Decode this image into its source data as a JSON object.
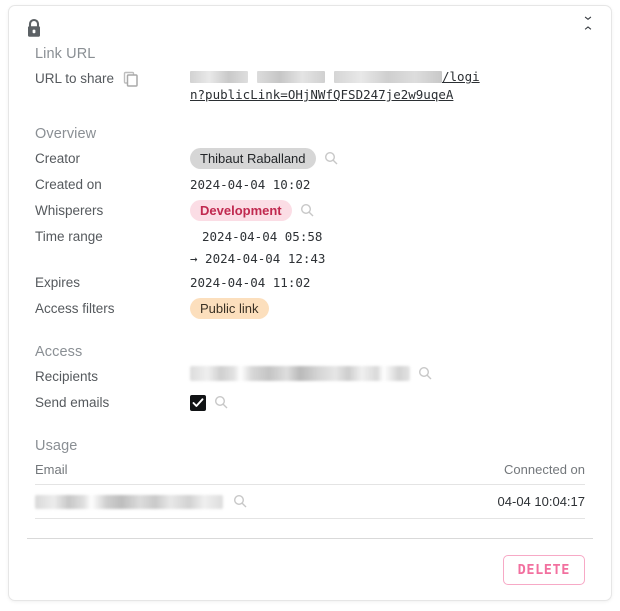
{
  "header": {
    "lock_icon": "lock-icon",
    "collapse_icon": "collapse-icon"
  },
  "link_url": {
    "title": "Link URL",
    "url_label": "URL to share",
    "copy_icon": "copy-icon",
    "url_visible_text": "/login?publicLink=OHjNWfQFSD247je2w9uqeA",
    "url_redacted": true
  },
  "overview": {
    "title": "Overview",
    "rows": [
      {
        "label": "Creator",
        "value": "Thibaut Raballand",
        "kind": "tag-grey",
        "search": true
      },
      {
        "label": "Created on",
        "value": "2024-04-04 10:02",
        "kind": "mono",
        "search": false
      },
      {
        "label": "Whisperers",
        "value": "Development",
        "kind": "tag-pink",
        "search": true
      },
      {
        "label": "Time range",
        "value": "2024-04-04 05:58",
        "value2": "→ 2024-04-04 12:43",
        "kind": "mono-2",
        "search": false
      },
      {
        "label": "Expires",
        "value": "2024-04-04 11:02",
        "kind": "mono",
        "search": false
      },
      {
        "label": "Access filters",
        "value": "Public link",
        "kind": "tag-orange",
        "search": false
      }
    ]
  },
  "access": {
    "title": "Access",
    "recipients_label": "Recipients",
    "recipients_value_redacted": true,
    "recipients_search_icon": "search-icon",
    "send_emails_label": "Send emails",
    "send_emails_checked": true,
    "send_emails_search_icon": "search-icon"
  },
  "usage": {
    "title": "Usage",
    "columns": [
      "Email",
      "Connected on"
    ],
    "rows": [
      {
        "email_redacted": true,
        "email_search_icon": "search-icon",
        "connected_on": "04-04 10:04:17"
      }
    ]
  },
  "footer": {
    "delete_label": "DELETE"
  },
  "colors": {
    "tag_grey_bg": "#d6d6d6",
    "tag_pink_bg": "#fbdde5",
    "tag_pink_fg": "#c0294f",
    "tag_orange_bg": "#fcdfbd",
    "delete_border": "#f7a9c6",
    "delete_text": "#f2709f"
  }
}
